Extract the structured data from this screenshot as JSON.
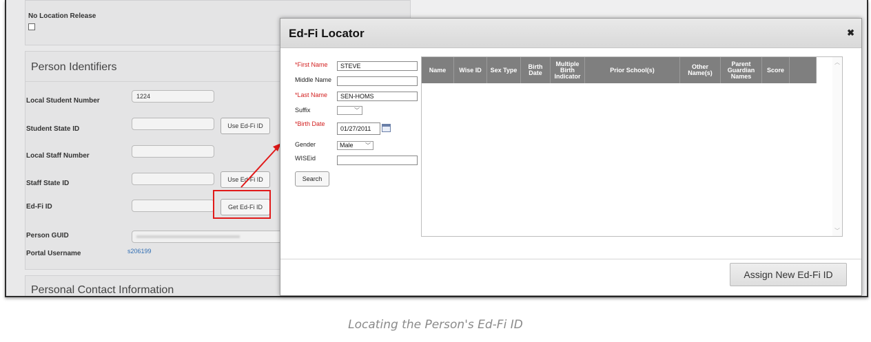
{
  "left_panel": {
    "no_location_release_label": "No Location Release",
    "person_identifiers_heading": "Person Identifiers",
    "fields": {
      "local_student_number_label": "Local Student Number",
      "local_student_number_value": "1224",
      "student_state_id_label": "Student State ID",
      "local_staff_number_label": "Local Staff Number",
      "staff_state_id_label": "Staff State ID",
      "ed_fi_id_label": "Ed-Fi ID",
      "person_guid_label": "Person GUID",
      "portal_username_label": "Portal Username",
      "portal_username_value": "s206199"
    },
    "buttons": {
      "use_ed_fi_id_1": "Use Ed-Fi ID",
      "use_ed_fi_id_2": "Use Ed-Fi ID",
      "get_ed_fi_id": "Get Ed-Fi ID"
    },
    "personal_contact_heading": "Personal Contact Information"
  },
  "modal": {
    "title": "Ed-Fi Locator",
    "close_glyph": "✖",
    "form": {
      "first_name_label": "*First Name",
      "first_name_value": "STEVE",
      "middle_name_label": "Middle Name",
      "middle_name_value": "",
      "last_name_label": "*Last Name",
      "last_name_value": "SEN-HOMS",
      "suffix_label": "Suffix",
      "suffix_value": "",
      "birth_date_label": "*Birth Date",
      "birth_date_value": "01/27/2011",
      "gender_label": "Gender",
      "gender_value": "Male",
      "wiseid_label": "WISEid",
      "wiseid_value": "",
      "search_button": "Search"
    },
    "grid_columns": [
      "Name",
      "Wise ID",
      "Sex Type",
      "Birth Date",
      "Multiple Birth Indicator",
      "Prior School(s)",
      "Other Name(s)",
      "Parent Guardian Names",
      "Score",
      ""
    ],
    "assign_button": "Assign New Ed-Fi ID"
  },
  "caption": "Locating the Person's Ed-Fi ID",
  "colors": {
    "highlight_red": "#e11919",
    "required_red": "#d21e1e",
    "grid_header": "#7f7f7f",
    "link_blue": "#2f6db3"
  }
}
